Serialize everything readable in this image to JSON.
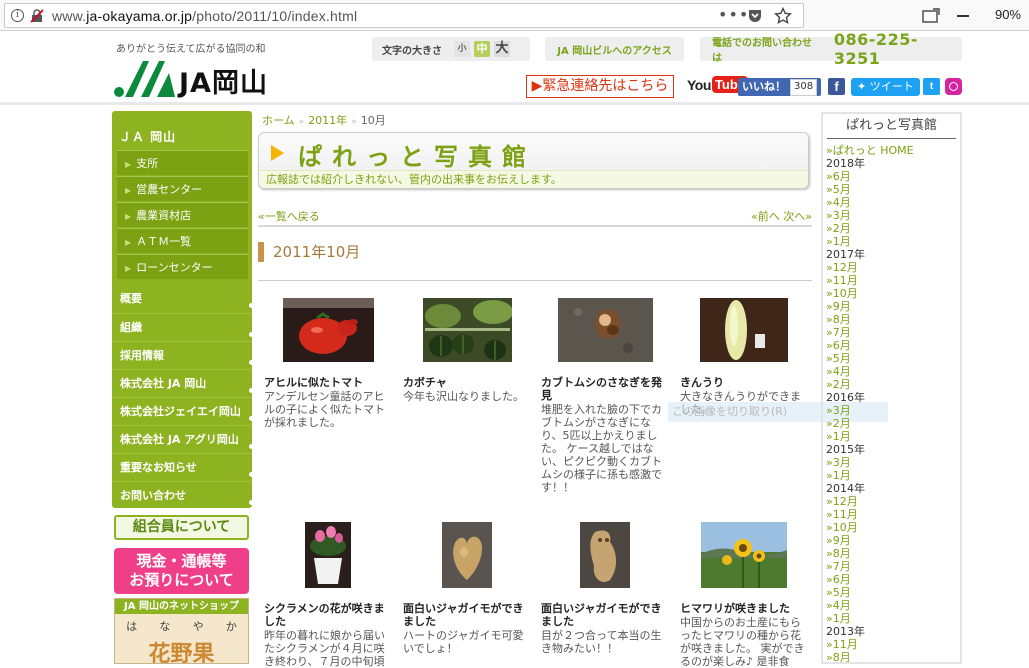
{
  "browser": {
    "url_prefix": "www.",
    "url_domain": "ja-okayama.or.jp",
    "url_path": "/photo/2011/10/index.html",
    "zoom": "90%"
  },
  "header": {
    "tagline": "ありがとう伝えて広がる協同の和",
    "logo_text": "JA岡山",
    "font_size_label": "文字の大きさ",
    "font_small": "小",
    "font_medium": "中",
    "font_large": "大",
    "access_label": "JA 岡山ビルへのアクセス",
    "phone_label": "電話でのお問い合わせは",
    "phone_number": "086-225-3251",
    "emergency_label": "▶緊急連絡先はこちら",
    "youtube_you": "You",
    "youtube_tube": "Tube",
    "like_label": "いいね！",
    "like_count": "308",
    "tweet_label": "ツイート"
  },
  "left_nav": {
    "head": "ＪＡ 岡山",
    "sub_items": [
      "支所",
      "営農センター",
      "農業資材店",
      "ＡＴＭ一覧",
      "ローンセンター"
    ],
    "main_items": [
      "概要",
      "組織",
      "採用情報",
      "株式会社 JA 岡山",
      "株式会社ジェイエイ岡山",
      "株式会社 JA アグリ岡山",
      "重要なお知らせ",
      "お問い合わせ"
    ],
    "members_banner": "組合員について",
    "deposit_line1": "現金・通帳等",
    "deposit_line2": "お預りについて",
    "shop_title": "JA 岡山のネットショップ",
    "shop_kana": [
      "は",
      "な",
      "や",
      "か"
    ],
    "shop_big": "花野果"
  },
  "breadcrumb": {
    "home": "ホーム",
    "year": "2011年",
    "current": "10月"
  },
  "page_title": "ぱれっと写真館",
  "page_subtitle": "広報誌では紹介しきれない、管内の出来事をお伝えします。",
  "nav": {
    "back_to_list": "«一覧へ戻る",
    "prev_next": "«前へ 次へ»"
  },
  "month_heading": "2011年10月",
  "photos": [
    {
      "title": "アヒルに似たトマト",
      "desc": "アンデルセン童話のアヒルの子によく似たトマトが採れました。"
    },
    {
      "title": "カボチャ",
      "desc": "今年も沢山なりました。"
    },
    {
      "title": "カブトムシのさなぎを発見",
      "desc": "堆肥を入れた臉の下でカブトムシがさなぎになり、5匹以上かえりました。 ケース越しではない、ピクピク動くカブトムシの様子に孫も感激です！！"
    },
    {
      "title": "きんうり",
      "desc": "大きなきんうりができました。"
    },
    {
      "title": "シクラメンの花が咲きました",
      "desc": "昨年の暮れに娘から届いたシクラメンが４月に咲き終わり、７月の中旬頃"
    },
    {
      "title": "面白いジャガイモができました",
      "desc": "ハートのジャガイモ可愛いでしょ！"
    },
    {
      "title": "面白いジャガイモができました",
      "desc": "目が２つ合って本当の生き物みたい！！"
    },
    {
      "title": "ヒマワリが咲きました",
      "desc": "中国からのお土産にもらったヒマワリの種から花が咲きました。 実ができるのが楽しみ♪ 是非食"
    }
  ],
  "ghost_text": "この画像を切り取り(R)",
  "right_sidebar": {
    "title": "ぱれっと写真館",
    "home_link": "»ぱれっと HOME",
    "archive": [
      {
        "year": "2018年",
        "months": [
          "»6月",
          "»5月",
          "»4月",
          "»3月",
          "»2月",
          "»1月"
        ]
      },
      {
        "year": "2017年",
        "months": [
          "»12月",
          "»11月",
          "»10月",
          "»9月",
          "»8月",
          "»7月",
          "»6月",
          "»5月",
          "»4月",
          "»2月"
        ]
      },
      {
        "year": "2016年",
        "months": [
          "»3月",
          "»2月",
          "»1月"
        ]
      },
      {
        "year": "2015年",
        "months": [
          "»3月",
          "»1月"
        ]
      },
      {
        "year": "2014年",
        "months": [
          "»12月",
          "»11月",
          "»10月",
          "»9月",
          "»8月",
          "»7月",
          "»6月",
          "»5月",
          "»4月",
          "»1月"
        ]
      },
      {
        "year": "2013年",
        "months": [
          "»11月",
          "»8月"
        ]
      }
    ]
  },
  "colors": {
    "brand_green": "#8db321",
    "link_green": "#7ca213",
    "accent_orange": "#f5b400",
    "emergency_red": "#dd3311"
  }
}
